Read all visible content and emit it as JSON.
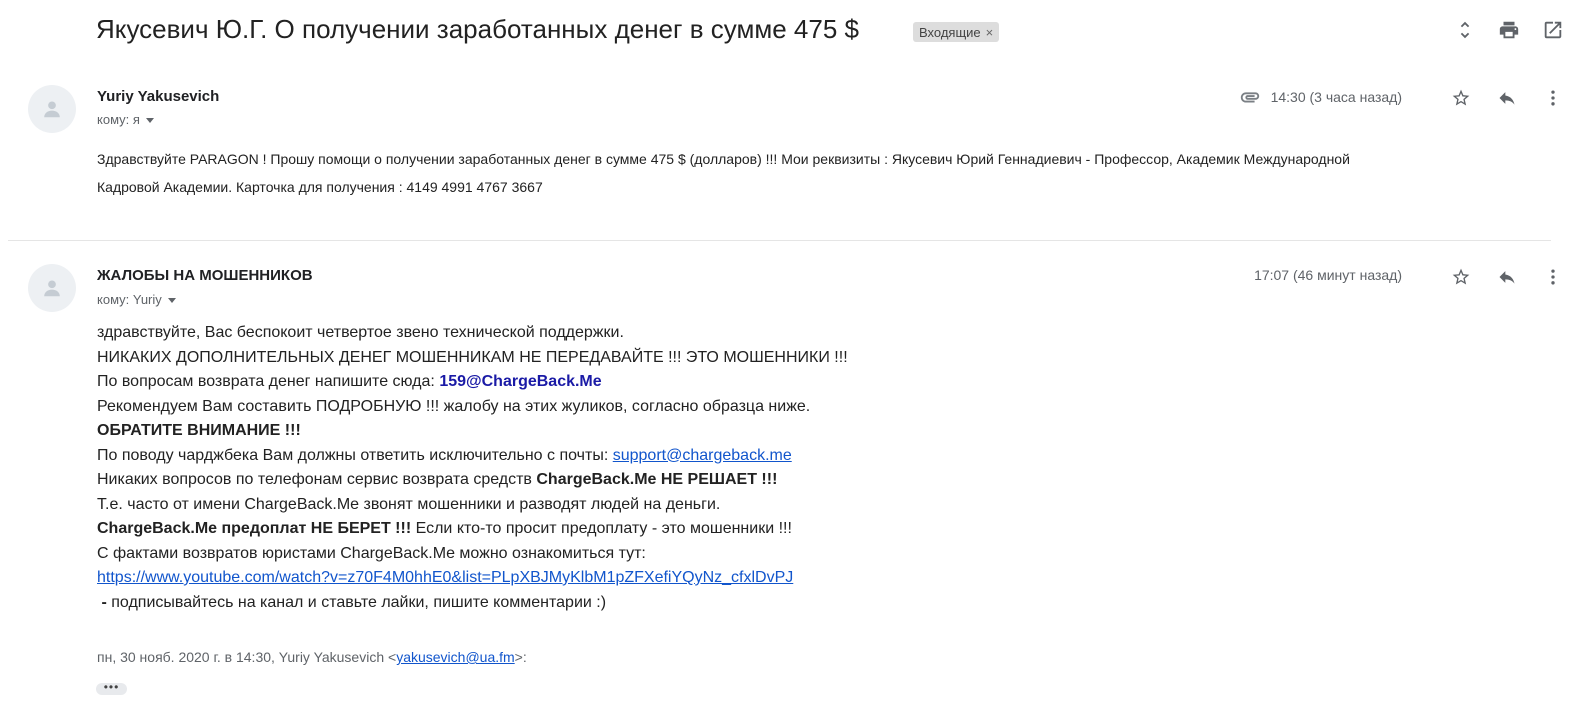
{
  "header": {
    "subject": "Якусевич Ю.Г. О получении заработанных денег в сумме 475 $",
    "label": "Входящие",
    "label_remove": "×"
  },
  "message1": {
    "sender": "Yuriy Yakusevich",
    "to": "кому: я",
    "time": "14:30 (3 часа назад)",
    "line1": "Здравствуйте PARAGON !  Прошу помощи о получении заработанных денег в сумме 475 $  (долларов)  !!! Мои реквизиты : Якусевич Юрий Геннадиевич - Профессор, Академик  Международной",
    "line2": "Кадровой Академии. Карточка для получения : 4149 4991 4767 3667"
  },
  "message2": {
    "sender": "ЖАЛОБЫ НА МОШЕННИКОВ",
    "to": "кому: Yuriy",
    "time": "17:07 (46 минут назад)",
    "l1": "здравствуйте, Вас беспокоит четвертое звено технической поддержки.",
    "l2": "НИКАКИХ ДОПОЛНИТЕЛЬНЫХ ДЕНЕГ МОШЕННИКАМ НЕ ПЕРЕДАВАЙТЕ !!! ЭТО МОШЕННИКИ !!!",
    "l3_text": "По вопросам возврата денег напишите сюда: ",
    "l3_email": "159@ChargeBack.Me",
    "l4": "Рекомендуем Вам составить ПОДРОБНУЮ !!! жалобу на этих жуликов, согласно образца ниже.",
    "l5": "ОБРАТИТЕ ВНИМАНИЕ !!!",
    "l6_text": "По поводу чарджбека Вам должны ответить исключительно с почты: ",
    "l6_link": "support@chargeback.me",
    "l7_text": "Никаких вопросов по телефонам сервис возврата средств ",
    "l7_bold": "ChargeBack.Me НЕ РЕШАЕТ !!!",
    "l8": "Т.е. часто от имени ChargeBack.Me звонят мошенники и разводят людей на деньги.",
    "l9_bold": "ChargeBack.Me предоплат НЕ БЕРЕТ !!!",
    "l9_text": " Если кто-то просит предоплату - это мошенники !!!",
    "l10": "С фактами возвратов юристами ChargeBack.Me можно ознакомиться тут:",
    "l11_link": "https://www.youtube.com/watch?v=z70F4M0hhE0&list=PLpXBJMyKlbM1pZFXefiYQyNz_cfxlDvPJ",
    "l12_dash": " -",
    "l12_text": " подписывайтесь на канал и ставьте лайки, пишите комментарии :)",
    "quote_prefix": "пн, 30 нояб. 2020 г. в 14:30, Yuriy Yakusevich <",
    "quote_email": "yakusevich@ua.fm",
    "quote_suffix": ">:",
    "more": "•••"
  },
  "icons": {
    "toolbar": [
      "expand-collapse-icon",
      "print-icon",
      "open-new-window-icon"
    ],
    "message": [
      "attachment-icon",
      "star-icon",
      "reply-icon",
      "more-vert-icon"
    ],
    "avatar": "person-icon"
  }
}
